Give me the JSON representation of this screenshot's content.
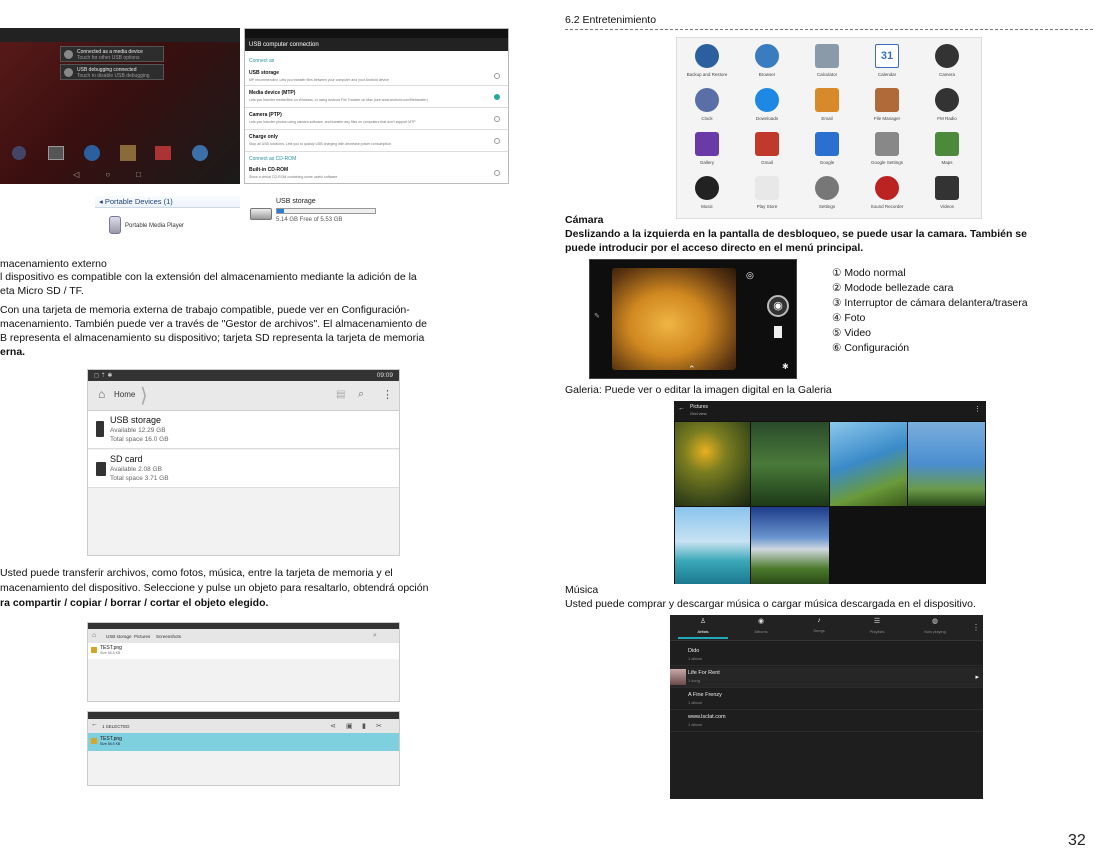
{
  "left": {
    "usb_connect_panel": {
      "notif_title_1": "Connected as a media device",
      "notif_sub_1": "Touch for other USB options",
      "notif_title_2": "USB debugging connected",
      "notif_sub_2": "Touch to disable USB debugging",
      "header": "USB computer connection",
      "connect_as": "Connect as",
      "opt1_title": "USB storage",
      "opt1_desc": "MP recommended. Lets you transfer files between your computer and your Android device",
      "opt2_title": "Media device (MTP)",
      "opt2_desc": "Lets you transfer media files on Windows, or using Android File Transfer on Mac (see www.android.com/filetransfer)",
      "opt3_title": "Camera (PTP)",
      "opt3_desc": "Lets you transfer photos using camera software, and transfer any files on computers that don't support MTP",
      "opt4_title": "Charge only",
      "opt4_desc": "Stop all USB functions. Lets you to quickly USB charging with decrease power consumption",
      "connect_cd": "Connect as CD-ROM",
      "opt5_title": "Built-in CD-ROM",
      "opt5_desc": "Show a virtual CD-ROM containing some useful software"
    },
    "portable_devices": "◂ Portable Devices (1)",
    "portable_media_player": "Portable Media Player",
    "usb_storage_label": "USB storage",
    "usb_storage_free": "5.14 GB Free of 5.53 GB",
    "section_title": "macenamiento externo",
    "para1_l1": "l dispositivo es compatible con la extensión del almacenamiento mediante la adición de la",
    "para1_l2": "eta Micro SD / TF.",
    "para2_l1": "Con una tarjeta de memoria externa de trabajo compatible, puede ver en Configuración-",
    "para2_l2": "macenamiento. También puede ver a través de \"Gestor de archivos\". El almacenamiento de",
    "para2_l3": "B representa el almacenamiento su dispositivo; tarjeta SD representa la tarjeta de memoria",
    "para2_l4": "erna.",
    "fm": {
      "status_time": "09:09",
      "home": "Home",
      "usb_title": "USB storage",
      "usb_avail": "Available 12.29 GB",
      "usb_total": "Total space 16.0 GB",
      "sd_title": "SD card",
      "sd_avail": "Available 2.08 GB",
      "sd_total": "Total space 3.71 GB"
    },
    "para3_l1": "Usted puede transferir archivos, como fotos, música, entre la tarjeta de memoria y el",
    "para3_l2": "macenamiento del dispositivo. Seleccione y pulse un objeto para resaltarlo, obtendrá opción",
    "para3_l3": "ra compartir / copiar / borrar / cortar el objeto elegido.",
    "fm2": {
      "crumb1": "USB storage",
      "crumb2": "Pictures",
      "crumb3": "Screenshots",
      "file": "TEST.png",
      "file_size": "Size 86.5 KB",
      "selected": "1 SELECTED",
      "file2": "TEST.png",
      "file2_size": "Size 86.5 KB"
    }
  },
  "right": {
    "section_title": "6.2 Entretenimiento",
    "apps": [
      "Backup and Restore",
      "Browser",
      "Calculator",
      "Calendar",
      "Camera",
      "Clock",
      "Downloads",
      "Email",
      "File Manager",
      "FM Radio",
      "Gallery",
      "Gmail",
      "Google",
      "Google Settings",
      "Maps",
      "Music",
      "Play Store",
      "Settings",
      "Sound Recorder",
      "Videos"
    ],
    "calendar_num": "31",
    "camara_title": "Cámara",
    "camara_l1": "Deslizando a la izquierda en la pantalla de desbloqueo, se puede usar la camara. También se",
    "camara_l2": "puede introducir por el acceso directo en el menú principal.",
    "cam_list": [
      "① Modo normal",
      "② Mododе bellezade cara",
      "③ Interruptor de cámara delantera/trasera",
      "④ Foto",
      "⑤ Video",
      "⑥ Configuración"
    ],
    "galeria": "Galeria: Puede ver o editar la imagen digital en la Galeria",
    "gallery_title": "Pictures",
    "gallery_sub": "Grid view",
    "musica_title": "Música",
    "musica_l1": "Usted puede comprar y descargar música o cargar música descargada en el dispositivo.",
    "music_tabs": [
      "Artists",
      "Albums",
      "Songs",
      "Playlists",
      "Now playing"
    ],
    "music_items": [
      {
        "name": "Dido",
        "sub": "1 album"
      },
      {
        "name": "Life For Rent",
        "sub": "1 song"
      },
      {
        "name": "A Fine Frenzy",
        "sub": "1 album"
      },
      {
        "name": "www.lsclat.com",
        "sub": "1 album"
      }
    ]
  },
  "page_number": "32"
}
